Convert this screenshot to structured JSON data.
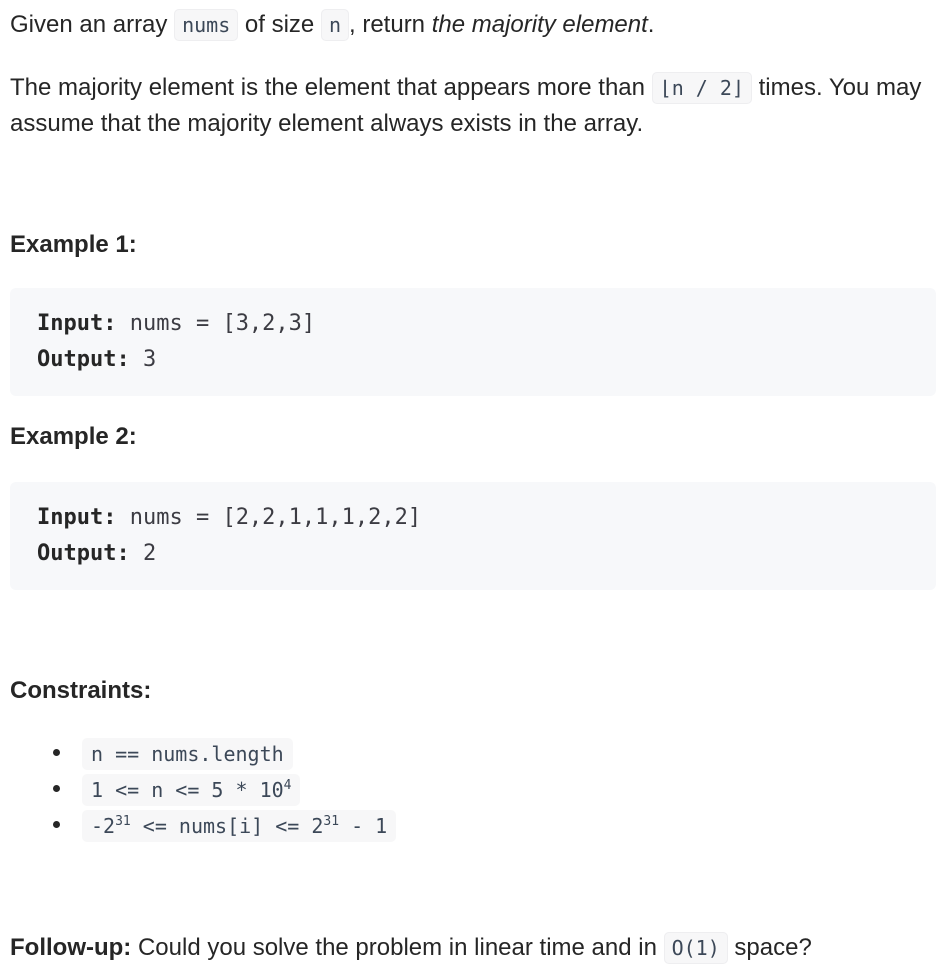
{
  "intro": {
    "before_nums": "Given an array ",
    "nums_code": "nums",
    "middle": " of size ",
    "n_code": "n",
    "after_n": ", return ",
    "emph": "the majority element",
    "end": "."
  },
  "definition": {
    "before_code": "The majority element is the element that appears more than ",
    "code": "⌊n / 2⌋",
    "after_code": " times. You may assume that the majority element always exists in the array."
  },
  "examples": [
    {
      "heading": "Example 1:",
      "input_label": "Input:",
      "input_value": " nums = [3,2,3]",
      "output_label": "Output:",
      "output_value": " 3"
    },
    {
      "heading": "Example 2:",
      "input_label": "Input:",
      "input_value": " nums = [2,2,1,1,1,2,2]",
      "output_label": "Output:",
      "output_value": " 2"
    }
  ],
  "constraints": {
    "heading": "Constraints:",
    "items": [
      {
        "text": "n == nums.length"
      },
      {
        "pre": "1 <= n <= 5 * 10",
        "sup": "4",
        "post": ""
      },
      {
        "pre": "-2",
        "sup": "31",
        "post": " <= nums[i] <= 2",
        "sup2": "31",
        "post2": " - 1"
      }
    ]
  },
  "followup": {
    "label": "Follow-up:",
    "before_code": " Could you solve the problem in linear time and in ",
    "code": "O(1)",
    "after_code": " space?"
  }
}
